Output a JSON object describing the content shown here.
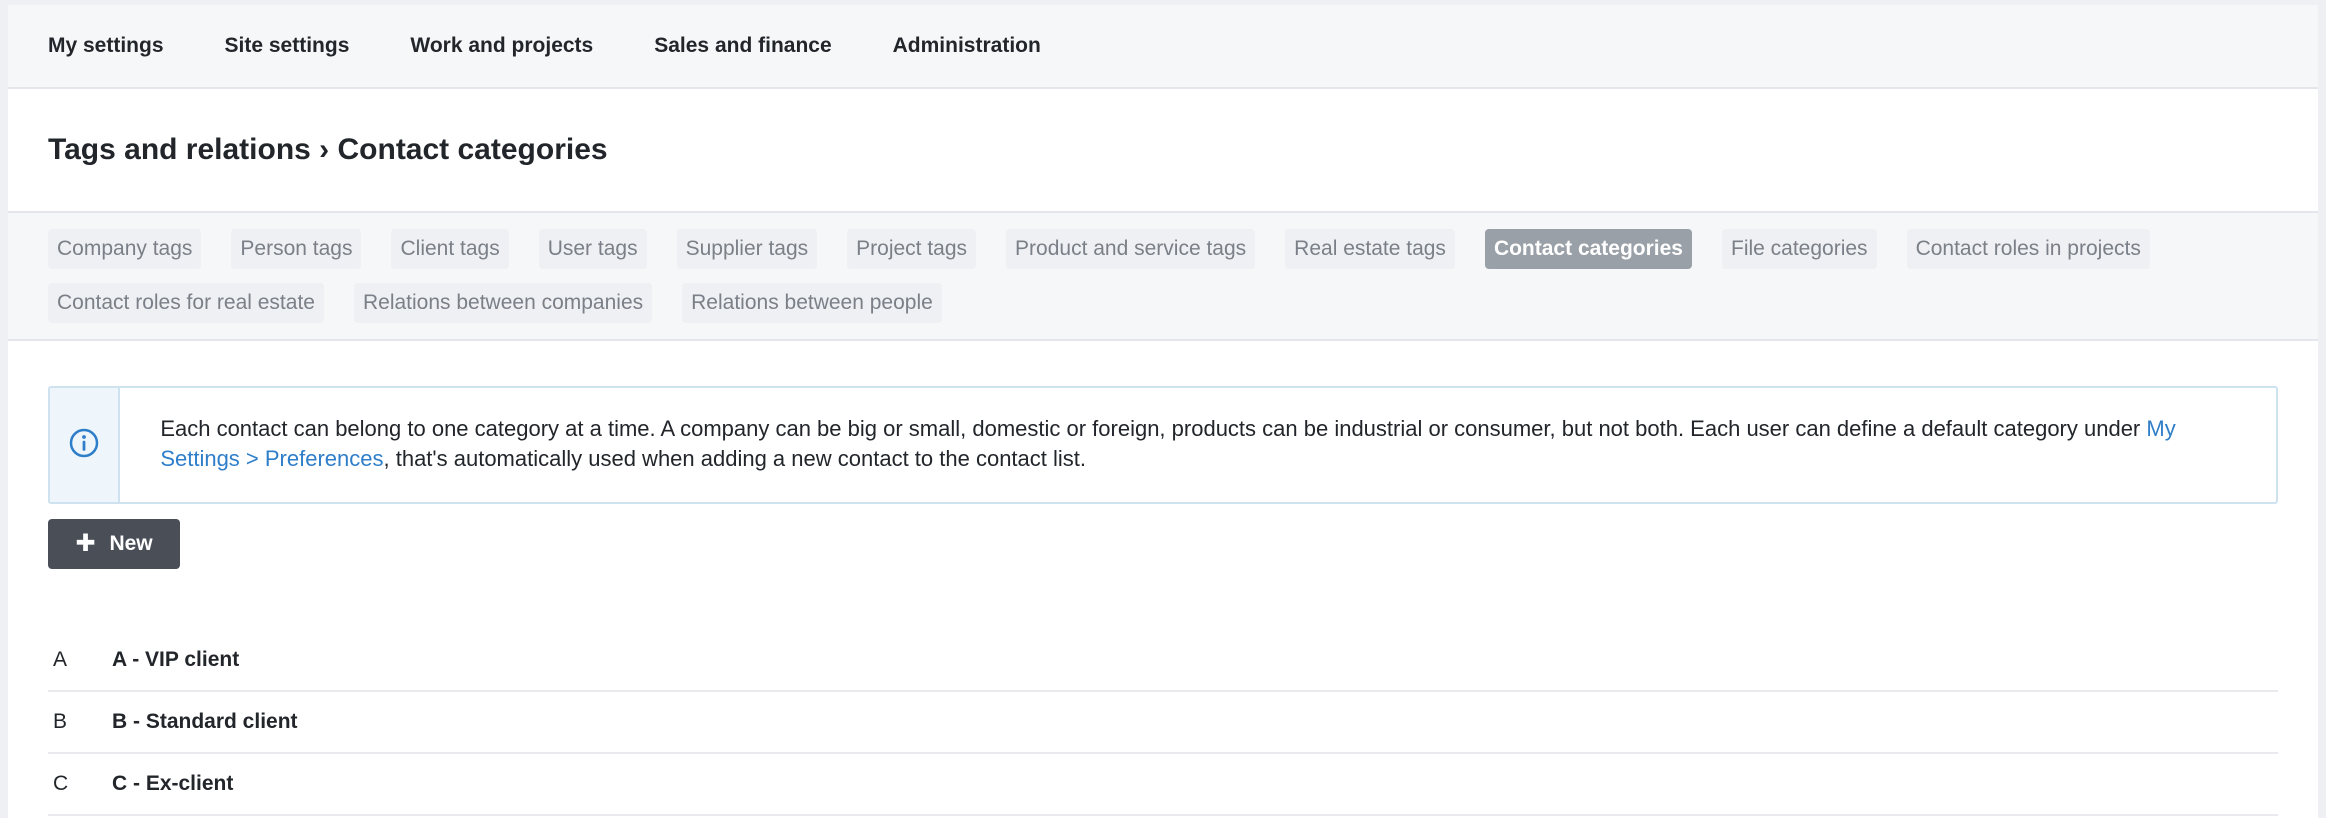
{
  "topnav": {
    "items": [
      "My settings",
      "Site settings",
      "Work and projects",
      "Sales and finance",
      "Administration"
    ]
  },
  "header": {
    "title": "Tags and relations › Contact categories"
  },
  "tabs": {
    "row1": [
      "Company tags",
      "Person tags",
      "Client tags",
      "User tags",
      "Supplier tags",
      "Project tags",
      "Product and service tags",
      "Real estate tags",
      "Contact categories",
      "File categories",
      "Contact roles in projects"
    ],
    "row2": [
      "Contact roles for real estate",
      "Relations between companies",
      "Relations between people"
    ],
    "active": "Contact categories"
  },
  "info": {
    "icon": "info-icon",
    "text_before": "Each contact can belong to one category at a time. A company can be big or small, domestic or foreign, products can be industrial or consumer, but not both. Each user can define a default category under ",
    "link": "My Settings > Preferences",
    "text_after": ", that's automatically used when adding a new contact to the contact list."
  },
  "toolbar": {
    "new_label": "New",
    "new_icon": "plus-icon"
  },
  "categories": [
    {
      "code": "A",
      "name": "A - VIP client"
    },
    {
      "code": "B",
      "name": "B - Standard client"
    },
    {
      "code": "C",
      "name": "C - Ex-client"
    }
  ],
  "colors": {
    "accent_link": "#2f7ec9",
    "active_tab": "#9aa0a8",
    "button": "#4a4f57"
  }
}
